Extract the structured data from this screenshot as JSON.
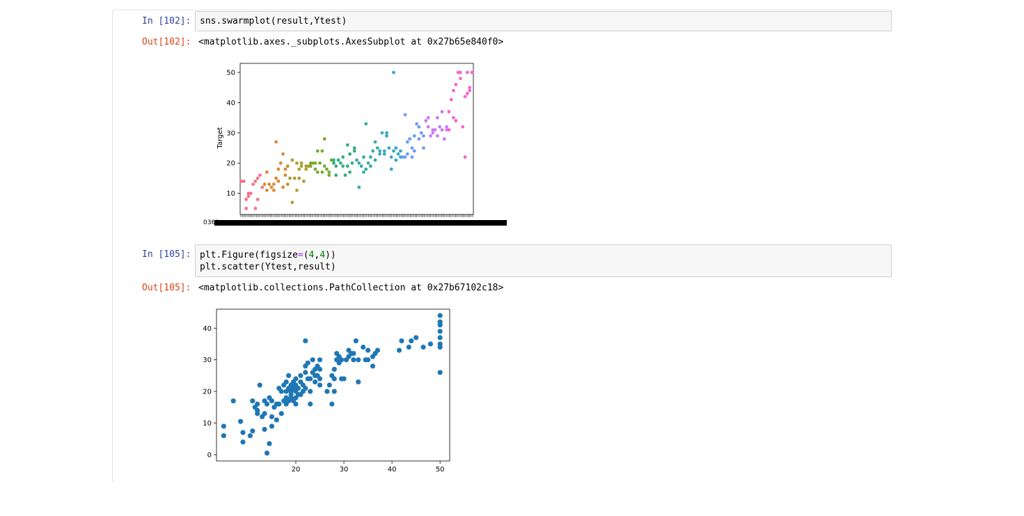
{
  "cells": [
    {
      "in_prompt": "In [102]:",
      "code": [
        "sns.swarmplot(result,Ytest)"
      ],
      "out_prompt": "Out[102]:",
      "out_text": "<matplotlib.axes._subplots.AxesSubplot at 0x27b65e840f0>"
    },
    {
      "in_prompt": "In [105]:",
      "code_line1": {
        "a": "plt.Figure(figsize",
        "eq": "=",
        "p1": "(",
        "n1": "4",
        "c": ",",
        "n2": "4",
        "p2": "))"
      },
      "code_line2": "plt.scatter(Ytest,result)",
      "out_prompt": "Out[105]:",
      "out_text": "<matplotlib.collections.PathCollection at 0x27b67102c18>"
    }
  ],
  "chart_data": [
    {
      "type": "scatter",
      "ylabel": "Target",
      "xlabel": "",
      "ylim": [
        3,
        53
      ],
      "yticks": [
        10,
        20,
        30,
        40,
        50
      ],
      "x_tick_labels_overlapping": "0369...",
      "grid": false,
      "colors": [
        "#f77189",
        "#dc8932",
        "#ae9d31",
        "#77ab31",
        "#33b07a",
        "#36ada4",
        "#38a9c5",
        "#6e9bf4",
        "#cc7af4",
        "#f565cc"
      ],
      "points": [
        [
          0.0,
          14
        ],
        [
          0.01,
          14
        ],
        [
          0.02,
          8
        ],
        [
          0.03,
          10
        ],
        [
          0.02,
          5
        ],
        [
          0.03,
          9
        ],
        [
          0.04,
          10
        ],
        [
          0.05,
          13
        ],
        [
          0.06,
          14
        ],
        [
          0.06,
          5
        ],
        [
          0.07,
          15
        ],
        [
          0.07,
          8
        ],
        [
          0.08,
          16
        ],
        [
          0.09,
          12
        ],
        [
          0.1,
          13
        ],
        [
          0.11,
          11
        ],
        [
          0.11,
          17
        ],
        [
          0.12,
          13
        ],
        [
          0.13,
          12
        ],
        [
          0.14,
          13
        ],
        [
          0.14,
          11
        ],
        [
          0.15,
          15
        ],
        [
          0.16,
          18
        ],
        [
          0.16,
          14
        ],
        [
          0.15,
          27
        ],
        [
          0.17,
          20
        ],
        [
          0.18,
          23
        ],
        [
          0.18,
          12
        ],
        [
          0.19,
          18
        ],
        [
          0.19,
          16
        ],
        [
          0.2,
          19
        ],
        [
          0.2,
          13
        ],
        [
          0.21,
          15
        ],
        [
          0.22,
          7
        ],
        [
          0.22,
          21
        ],
        [
          0.23,
          15
        ],
        [
          0.24,
          11
        ],
        [
          0.24,
          20
        ],
        [
          0.25,
          15
        ],
        [
          0.25,
          18
        ],
        [
          0.26,
          20
        ],
        [
          0.26,
          19
        ],
        [
          0.27,
          14
        ],
        [
          0.28,
          19
        ],
        [
          0.28,
          18
        ],
        [
          0.29,
          19
        ],
        [
          0.3,
          19
        ],
        [
          0.3,
          20
        ],
        [
          0.31,
          20
        ],
        [
          0.32,
          20
        ],
        [
          0.32,
          18
        ],
        [
          0.33,
          17
        ],
        [
          0.33,
          24
        ],
        [
          0.34,
          20
        ],
        [
          0.35,
          24
        ],
        [
          0.35,
          17
        ],
        [
          0.36,
          28
        ],
        [
          0.36,
          19
        ],
        [
          0.37,
          18
        ],
        [
          0.38,
          16
        ],
        [
          0.38,
          17
        ],
        [
          0.39,
          21
        ],
        [
          0.4,
          20
        ],
        [
          0.4,
          21
        ],
        [
          0.41,
          19
        ],
        [
          0.41,
          16
        ],
        [
          0.42,
          21
        ],
        [
          0.43,
          20
        ],
        [
          0.44,
          19
        ],
        [
          0.44,
          22
        ],
        [
          0.45,
          16
        ],
        [
          0.46,
          26
        ],
        [
          0.46,
          19
        ],
        [
          0.47,
          23
        ],
        [
          0.47,
          17
        ],
        [
          0.48,
          20
        ],
        [
          0.49,
          25
        ],
        [
          0.49,
          24
        ],
        [
          0.5,
          21
        ],
        [
          0.51,
          20
        ],
        [
          0.51,
          12
        ],
        [
          0.52,
          19
        ],
        [
          0.53,
          22
        ],
        [
          0.53,
          17
        ],
        [
          0.54,
          18
        ],
        [
          0.54,
          33
        ],
        [
          0.55,
          20
        ],
        [
          0.56,
          19
        ],
        [
          0.56,
          22
        ],
        [
          0.57,
          24
        ],
        [
          0.58,
          27
        ],
        [
          0.58,
          21
        ],
        [
          0.59,
          25
        ],
        [
          0.6,
          24
        ],
        [
          0.6,
          23
        ],
        [
          0.61,
          30
        ],
        [
          0.62,
          24
        ],
        [
          0.62,
          23
        ],
        [
          0.63,
          29
        ],
        [
          0.63,
          30
        ],
        [
          0.64,
          25
        ],
        [
          0.65,
          22
        ],
        [
          0.65,
          18
        ],
        [
          0.66,
          24
        ],
        [
          0.67,
          21
        ],
        [
          0.67,
          25
        ],
        [
          0.68,
          23
        ],
        [
          0.66,
          50
        ],
        [
          0.69,
          22
        ],
        [
          0.69,
          24
        ],
        [
          0.7,
          22
        ],
        [
          0.71,
          22
        ],
        [
          0.71,
          36
        ],
        [
          0.72,
          23
        ],
        [
          0.72,
          27
        ],
        [
          0.73,
          28
        ],
        [
          0.74,
          25
        ],
        [
          0.74,
          22
        ],
        [
          0.75,
          24
        ],
        [
          0.75,
          29
        ],
        [
          0.76,
          33
        ],
        [
          0.77,
          32
        ],
        [
          0.77,
          28
        ],
        [
          0.78,
          30
        ],
        [
          0.79,
          25
        ],
        [
          0.79,
          29
        ],
        [
          0.8,
          34
        ],
        [
          0.81,
          35
        ],
        [
          0.81,
          32
        ],
        [
          0.82,
          29
        ],
        [
          0.83,
          31
        ],
        [
          0.83,
          30
        ],
        [
          0.84,
          31
        ],
        [
          0.85,
          35
        ],
        [
          0.85,
          29
        ],
        [
          0.86,
          32
        ],
        [
          0.87,
          31
        ],
        [
          0.87,
          37
        ],
        [
          0.88,
          28
        ],
        [
          0.89,
          31
        ],
        [
          0.89,
          32
        ],
        [
          0.9,
          31
        ],
        [
          0.9,
          37
        ],
        [
          0.91,
          41
        ],
        [
          0.92,
          35
        ],
        [
          0.92,
          44
        ],
        [
          0.93,
          34
        ],
        [
          0.93,
          46
        ],
        [
          0.94,
          50
        ],
        [
          0.95,
          50
        ],
        [
          0.95,
          48
        ],
        [
          0.96,
          32
        ],
        [
          0.97,
          22
        ],
        [
          0.97,
          42
        ],
        [
          0.98,
          43
        ],
        [
          0.98,
          50
        ],
        [
          0.99,
          44
        ],
        [
          0.99,
          45
        ],
        [
          1.0,
          50
        ],
        [
          1.0,
          50
        ]
      ]
    },
    {
      "type": "scatter",
      "xlabel": "",
      "ylabel": "",
      "xlim": [
        3.5,
        52
      ],
      "ylim": [
        -2,
        46
      ],
      "xticks": [
        20,
        30,
        40,
        50
      ],
      "yticks": [
        0,
        10,
        20,
        30,
        40
      ],
      "color": "#1f77b4",
      "grid": false,
      "points": [
        [
          5,
          9
        ],
        [
          5,
          6
        ],
        [
          7,
          17
        ],
        [
          8.5,
          10.5
        ],
        [
          9,
          4
        ],
        [
          9,
          7
        ],
        [
          10.5,
          6
        ],
        [
          11,
          7.5
        ],
        [
          11,
          17
        ],
        [
          11.5,
          15
        ],
        [
          12,
          13
        ],
        [
          12,
          16
        ],
        [
          12.5,
          22
        ],
        [
          12,
          14
        ],
        [
          13,
          12
        ],
        [
          13.5,
          17
        ],
        [
          13.5,
          13
        ],
        [
          13.5,
          8
        ],
        [
          14,
          0.5
        ],
        [
          14,
          16
        ],
        [
          14.5,
          18
        ],
        [
          14.5,
          3.5
        ],
        [
          15,
          17
        ],
        [
          15,
          12
        ],
        [
          15,
          9
        ],
        [
          15.5,
          15
        ],
        [
          16,
          16
        ],
        [
          16,
          11
        ],
        [
          16.5,
          21
        ],
        [
          16.5,
          16
        ],
        [
          17,
          20
        ],
        [
          17,
          13
        ],
        [
          17.5,
          22
        ],
        [
          17.5,
          17
        ],
        [
          18,
          23
        ],
        [
          18,
          20
        ],
        [
          18,
          18
        ],
        [
          18,
          16
        ],
        [
          18.5,
          21
        ],
        [
          18.5,
          17
        ],
        [
          18.5,
          25
        ],
        [
          19,
          22
        ],
        [
          19,
          20
        ],
        [
          19,
          19
        ],
        [
          19,
          18
        ],
        [
          19.5,
          23
        ],
        [
          19.5,
          21
        ],
        [
          19.5,
          17
        ],
        [
          20,
          24
        ],
        [
          20,
          22
        ],
        [
          20,
          20
        ],
        [
          20,
          18
        ],
        [
          20,
          16
        ],
        [
          20.5,
          21
        ],
        [
          20.5,
          19
        ],
        [
          21,
          25
        ],
        [
          21,
          23
        ],
        [
          21,
          19
        ],
        [
          21.5,
          22
        ],
        [
          21.5,
          20
        ],
        [
          22,
          36
        ],
        [
          22,
          28
        ],
        [
          22,
          26
        ],
        [
          22,
          21
        ],
        [
          22.5,
          29
        ],
        [
          22.5,
          24
        ],
        [
          23,
          24
        ],
        [
          23,
          20
        ],
        [
          23,
          16
        ],
        [
          23.5,
          30
        ],
        [
          23.5,
          26
        ],
        [
          24,
          27
        ],
        [
          24,
          25
        ],
        [
          24,
          23
        ],
        [
          24.5,
          28
        ],
        [
          24.5,
          25
        ],
        [
          25,
          30
        ],
        [
          25,
          27
        ],
        [
          25,
          24
        ],
        [
          25,
          22
        ],
        [
          26.5,
          20
        ],
        [
          27,
          22
        ],
        [
          27.5,
          25
        ],
        [
          27.5,
          16
        ],
        [
          28,
          24
        ],
        [
          28,
          20
        ],
        [
          28,
          27
        ],
        [
          28.5,
          30
        ],
        [
          28.5,
          32
        ],
        [
          29,
          31
        ],
        [
          29,
          29
        ],
        [
          29.5,
          30
        ],
        [
          29.5,
          24
        ],
        [
          30,
          24
        ],
        [
          30.5,
          30
        ],
        [
          31,
          31
        ],
        [
          31,
          33
        ],
        [
          31.5,
          32
        ],
        [
          32,
          32
        ],
        [
          32,
          30
        ],
        [
          32.5,
          36
        ],
        [
          33,
          30
        ],
        [
          33,
          23
        ],
        [
          34,
          34
        ],
        [
          34.5,
          30
        ],
        [
          35,
          33
        ],
        [
          35,
          30
        ],
        [
          36,
          31
        ],
        [
          36,
          28
        ],
        [
          36.5,
          32
        ],
        [
          37,
          33
        ],
        [
          41.5,
          33
        ],
        [
          42,
          36
        ],
        [
          43.5,
          34
        ],
        [
          44,
          36
        ],
        [
          45,
          37
        ],
        [
          46.5,
          34
        ],
        [
          48,
          35
        ],
        [
          50,
          44
        ],
        [
          50,
          41
        ],
        [
          50,
          39
        ],
        [
          50,
          37
        ],
        [
          50,
          35
        ],
        [
          50,
          34
        ],
        [
          50,
          26
        ],
        [
          50,
          42
        ]
      ]
    }
  ]
}
